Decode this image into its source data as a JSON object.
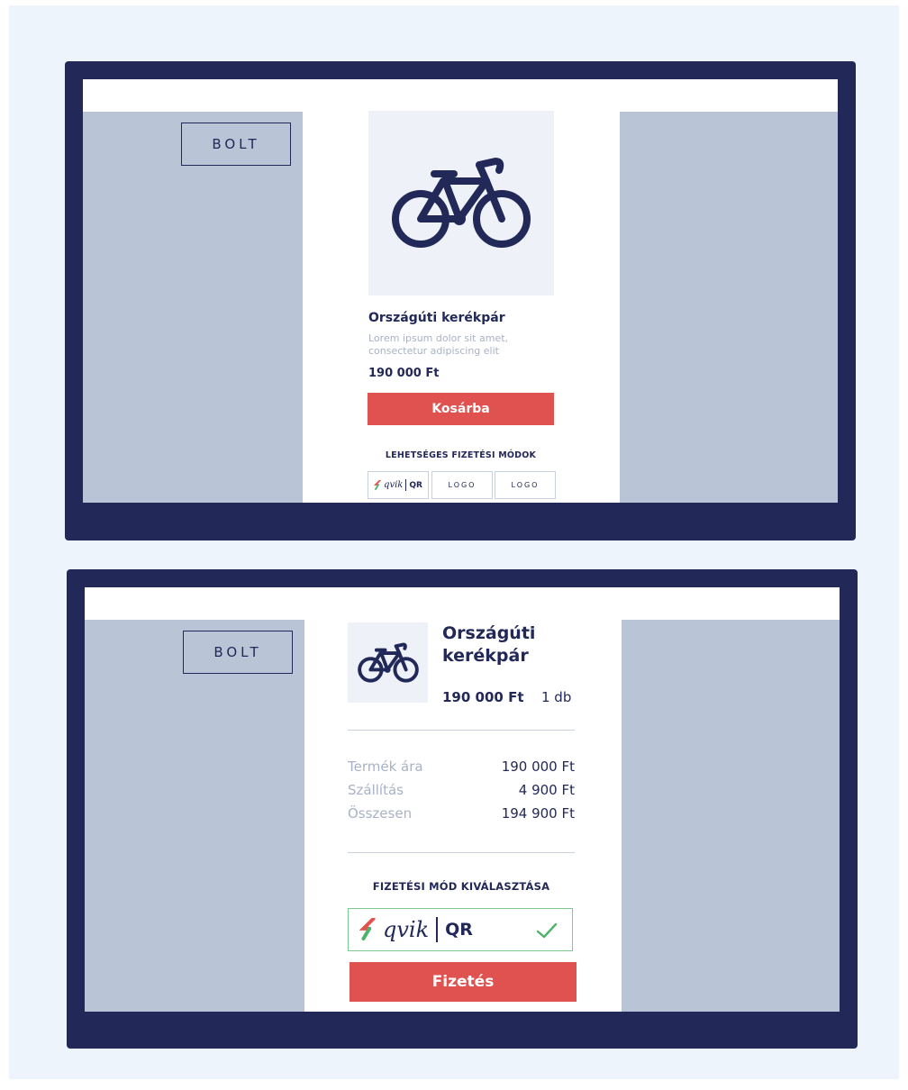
{
  "brand_colors": {
    "navy": "#222858",
    "red": "#e0524f",
    "panel": "#b9c5d7",
    "check_green": "#4db36a"
  },
  "icons": {
    "bicycle": "bicycle-icon",
    "qvik": "qvik-logo-icon",
    "check": "check-icon"
  },
  "product_screen": {
    "shop_label": "BOLT",
    "product_title": "Országúti kerékpár",
    "description_line1": "Lorem ipsum dolor sit amet,",
    "description_line2": "consectetur adipiscing elit",
    "price": "190 000 Ft",
    "add_to_cart_label": "Kosárba",
    "payment_methods_caption": "LEHETSÉGES FIZETÉSI MÓDOK",
    "payment_logos": [
      {
        "brand": "qvik",
        "word": "qvik",
        "suffix": "QR"
      },
      {
        "label": "LOGO"
      },
      {
        "label": "LOGO"
      }
    ]
  },
  "checkout_screen": {
    "shop_label": "BOLT",
    "product_title_line1": "Országúti",
    "product_title_line2": "kerékpár",
    "price": "190 000 Ft",
    "quantity": "1 db",
    "summary": [
      {
        "label": "Termék ára",
        "value": "190 000 Ft"
      },
      {
        "label": "Szállítás",
        "value": "4 900 Ft"
      },
      {
        "label": "Összesen",
        "value": "194 900 Ft"
      }
    ],
    "payment_select_caption": "FIZETÉSI MÓD KIVÁLASZTÁSA",
    "selected_payment": {
      "brand": "qvik",
      "word": "qvik",
      "suffix": "QR",
      "selected": true
    },
    "pay_button_label": "Fizetés"
  }
}
